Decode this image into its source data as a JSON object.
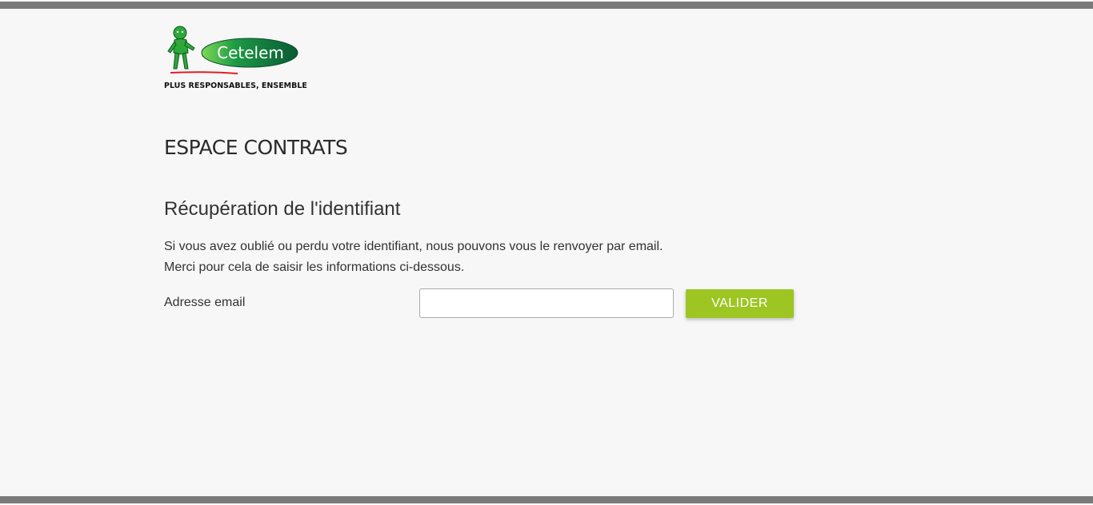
{
  "brand": {
    "logo_text": "Cetelem",
    "tagline": "PLUS RESPONSABLES, ENSEMBLE",
    "colors": {
      "green_dark": "#0b6b3a",
      "green_light": "#3fbf2f",
      "red_accent": "#e01e25"
    }
  },
  "page": {
    "title": "ESPACE CONTRATS",
    "section_title": "Récupération de l'identifiant",
    "intro_line1": "Si vous avez oublié ou perdu votre identifiant, nous pouvons vous le renvoyer par email.",
    "intro_line2": "Merci pour cela de saisir les informations ci-dessous."
  },
  "form": {
    "email_label": "Adresse email",
    "email_value": "",
    "email_placeholder": "",
    "submit_label": "VALIDER"
  },
  "colors": {
    "background": "#f7f7f7",
    "frame_bar": "#7a7a7a",
    "button": "#9dc623",
    "text": "#333333"
  }
}
